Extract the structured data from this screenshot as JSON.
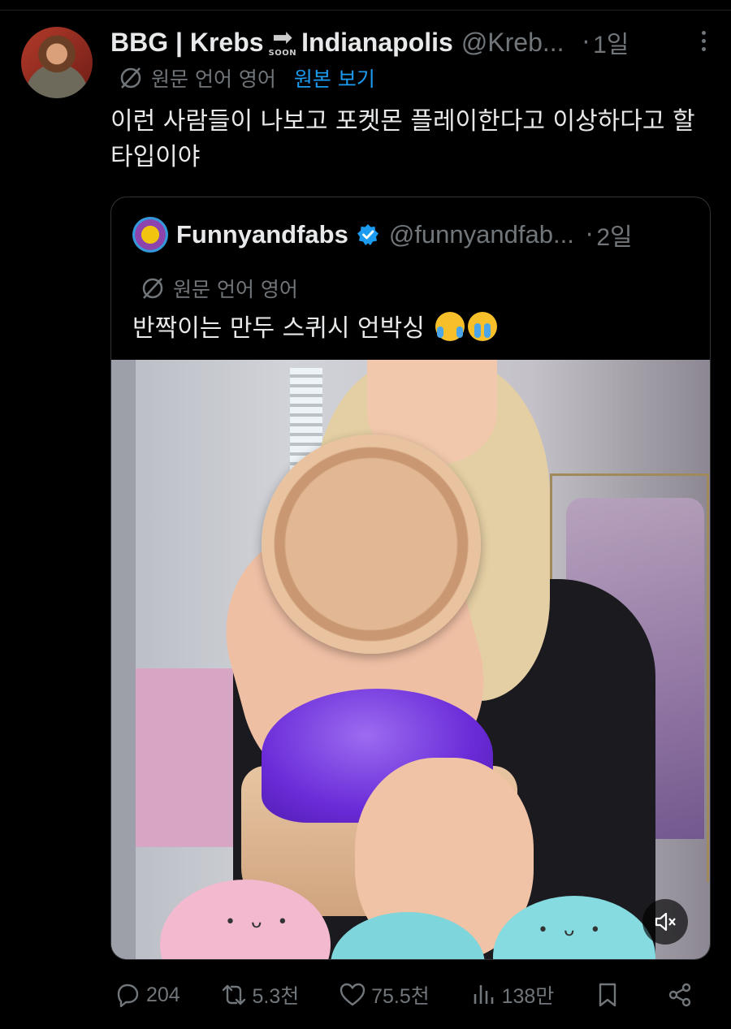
{
  "post": {
    "author_name": "BBG | Krebs",
    "name_emoji": "soon-arrow",
    "soon_label": "SOON",
    "author_location": "Indianapolis",
    "handle": "@Kreb...",
    "separator": "·",
    "time": "1일",
    "translation_label": "원문 언어 영어",
    "show_original": "원본 보기",
    "text": "이런 사람들이 나보고 포켓몬 플레이한다고 이상하다고 할 타입이야"
  },
  "quote": {
    "author_name": "Funnyandfabs",
    "verified": true,
    "handle": "@funnyandfab...",
    "separator": "·",
    "time": "2일",
    "translation_label": "원문 언어 영어",
    "text": "반짝이는 만두 스퀴시 언박싱",
    "emojis": [
      "laughing-tears",
      "crying"
    ]
  },
  "actions": {
    "replies": "204",
    "reposts": "5.3천",
    "likes": "75.5천",
    "views": "138만"
  },
  "colors": {
    "background": "#000000",
    "text": "#e7e9ea",
    "muted": "#71767b",
    "link": "#1d9bf0",
    "border": "#2f3336"
  }
}
